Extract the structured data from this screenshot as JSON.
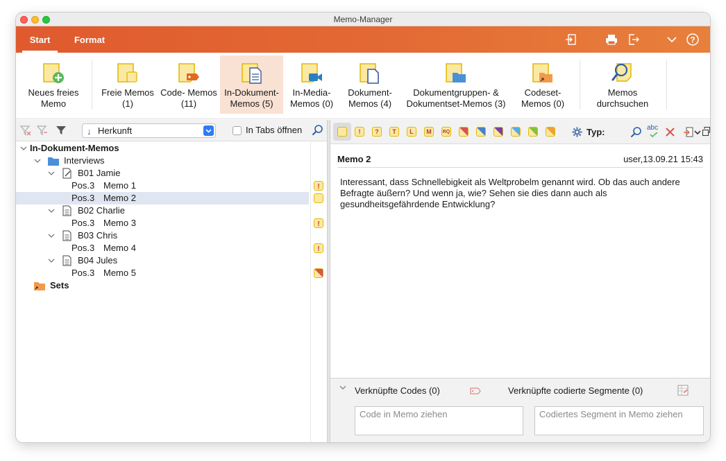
{
  "window": {
    "title": "Memo-Manager"
  },
  "ribbon_tabs": [
    {
      "label": "Start",
      "active": true
    },
    {
      "label": "Format",
      "active": false
    }
  ],
  "header_icons": [
    "export-icon",
    "print-icon",
    "exit-icon",
    "chevron-down-icon",
    "help-icon"
  ],
  "ribbon": {
    "new_memo": "Neues freies Memo",
    "free_memos": "Freie Memos (1)",
    "code_memos": "Code- Memos (11)",
    "indoc_memos": "In-Dokument-Memos (5)",
    "inmedia_memos": "In-Media-Memos (0)",
    "doc_memos": "Dokument-Memos (4)",
    "docgroup_memos": "Dokumentgruppen- & Dokumentset-Memos (3)",
    "codeset_memos": "Codeset-Memos (0)",
    "search_memos": "Memos durchsuchen"
  },
  "left_toolbar": {
    "sort_value": "Herkunft",
    "tabs_label": "In Tabs öffnen"
  },
  "tree": {
    "root": "In-Dokument-Memos",
    "interviews": "Interviews",
    "sets": "Sets",
    "docs": [
      {
        "name": "B01 Jamie",
        "memos": [
          {
            "pos": "Pos.3",
            "memo": "Memo 1"
          },
          {
            "pos": "Pos.3",
            "memo": "Memo 2"
          }
        ]
      },
      {
        "name": "B02 Charlie",
        "memos": [
          {
            "pos": "Pos.3",
            "memo": "Memo 3"
          }
        ]
      },
      {
        "name": "B03 Chris",
        "memos": [
          {
            "pos": "Pos.3",
            "memo": "Memo 4"
          }
        ]
      },
      {
        "name": "B04 Jules",
        "memos": [
          {
            "pos": "Pos.3",
            "memo": "Memo 5"
          }
        ]
      }
    ]
  },
  "right_toolbar": {
    "type_label": "Typ:",
    "marker_letters": [
      "!",
      "?",
      "T",
      "L",
      "M",
      "RQ"
    ],
    "spell_label": "abc"
  },
  "memo": {
    "title": "Memo 2",
    "meta": "user,13.09.21 15:43",
    "text": "Interessant, dass Schnellebigkeit als Weltprobelm genannt wird. Ob das auch andere Befragte äußern? Und wenn ja, wie? Sehen sie dies dann auch als gesundheitsgefährdende Entwicklung?"
  },
  "bottom": {
    "linked_codes": "Verknüpfte Codes (0)",
    "linked_segments": "Verknüpfte codierte Segmente (0)",
    "code_placeholder": "Code in Memo ziehen",
    "segment_placeholder": "Codiertes Segment in Memo ziehen"
  },
  "colors": {
    "accent": "#e05a2e",
    "memo_yellow": "#fbe9a3",
    "selection": "#dfe6f1",
    "ribbon_selected": "#f9e1d3"
  }
}
